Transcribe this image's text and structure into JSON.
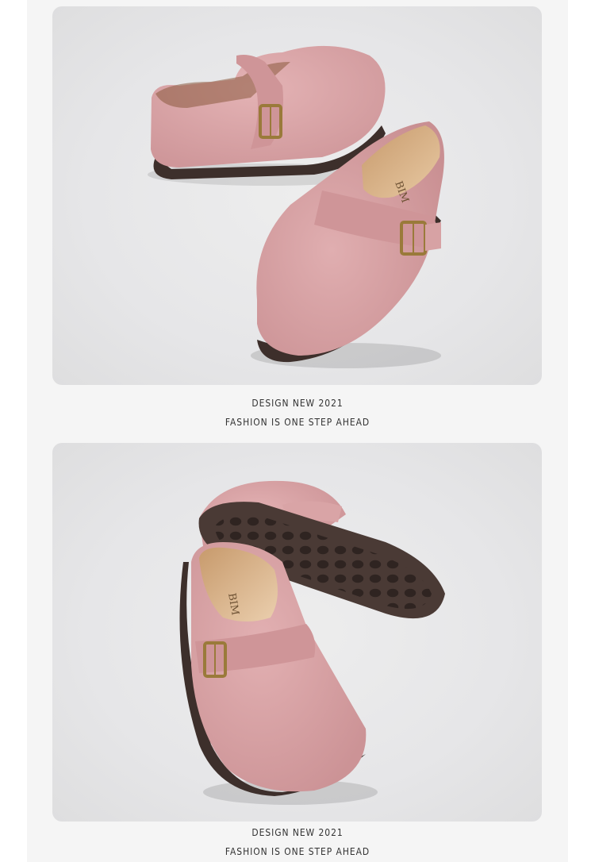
{
  "colors": {
    "page_background": "#ffffff",
    "column_background": "#f5f5f5",
    "photo_background": "#e6e6e8",
    "shoe_suede": "#dba6a8",
    "sole": "#3d2f2b",
    "buckle": "#9a7a3a",
    "caption_text": "#333333"
  },
  "sections": [
    {
      "image": {
        "subject": "pink suede buckle clogs pair, side view",
        "insole_brand_text": "BIM"
      },
      "caption": {
        "line1": "DESIGN NEW 2021",
        "line2": "FASHION IS ONE STEP AHEAD"
      }
    },
    {
      "image": {
        "subject": "pink suede buckle clogs pair, sole view",
        "insole_brand_text": "BIM"
      },
      "caption": {
        "line1": "DESIGN NEW 2021",
        "line2": "FASHION IS ONE STEP AHEAD"
      }
    }
  ]
}
